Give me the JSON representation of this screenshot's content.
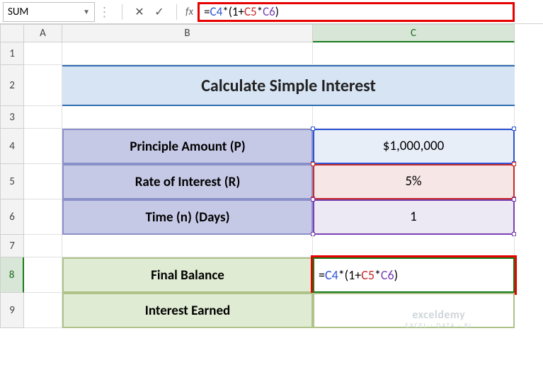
{
  "name_box": "SUM",
  "formula_bar": "=C4*(1+C5*C6)",
  "columns": {
    "A": "A",
    "B": "B",
    "C": "C"
  },
  "rows": [
    "1",
    "2",
    "3",
    "4",
    "5",
    "6",
    "7",
    "8",
    "9"
  ],
  "title": "Calculate Simple Interest",
  "labels": {
    "principle": "Principle Amount (P)",
    "rate": "Rate of Interest (R)",
    "time": "Time (n) (Days)",
    "final_balance": "Final Balance",
    "interest_earned": "Interest Earned"
  },
  "values": {
    "principle": "$1,000,000",
    "rate": "5%",
    "time": "1"
  },
  "formula_tokens": {
    "eq": "=",
    "c4": "C4",
    "mid1": "*(1+",
    "c5": "C5",
    "mid2": "*",
    "c6": "C6",
    "end": ")"
  },
  "watermark": {
    "brand": "exceldemy",
    "tagline": "EXCEL · DATA · BI"
  }
}
